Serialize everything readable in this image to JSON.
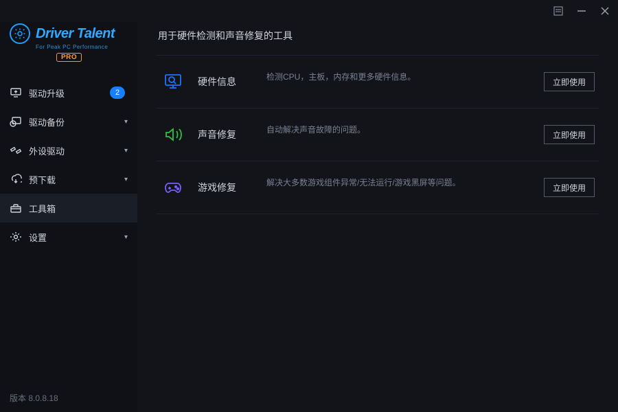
{
  "app": {
    "name": "Driver Talent",
    "tagline": "For Peak PC Performance",
    "badge": "PRO",
    "version_label": "版本 8.0.8.18"
  },
  "sidebar": {
    "items": [
      {
        "label": "驱动升级",
        "badge": "2",
        "has_caret": false,
        "icon": "monitor-up"
      },
      {
        "label": "驱动备份",
        "badge": null,
        "has_caret": true,
        "icon": "clock-monitor"
      },
      {
        "label": "外设驱动",
        "badge": null,
        "has_caret": true,
        "icon": "peripheral"
      },
      {
        "label": "预下载",
        "badge": null,
        "has_caret": true,
        "icon": "download-cloud"
      },
      {
        "label": "工具箱",
        "badge": null,
        "has_caret": false,
        "icon": "toolbox"
      },
      {
        "label": "设置",
        "badge": null,
        "has_caret": true,
        "icon": "gear"
      }
    ],
    "active_index": 4
  },
  "page": {
    "title": "用于硬件检测和声音修复的工具",
    "use_button_label": "立即使用",
    "tools": [
      {
        "name": "硬件信息",
        "desc": "检测CPU，主板，内存和更多硬件信息。",
        "icon": "hw-info",
        "icon_color": "#1b73ff"
      },
      {
        "name": "声音修复",
        "desc": "自动解决声音故障的问题。",
        "icon": "sound-fix",
        "icon_color": "#2fc23d"
      },
      {
        "name": "游戏修复",
        "desc": "解决大多数游戏组件异常/无法运行/游戏黑屏等问题。",
        "icon": "game-fix",
        "icon_color": "#7a5cff"
      }
    ]
  }
}
